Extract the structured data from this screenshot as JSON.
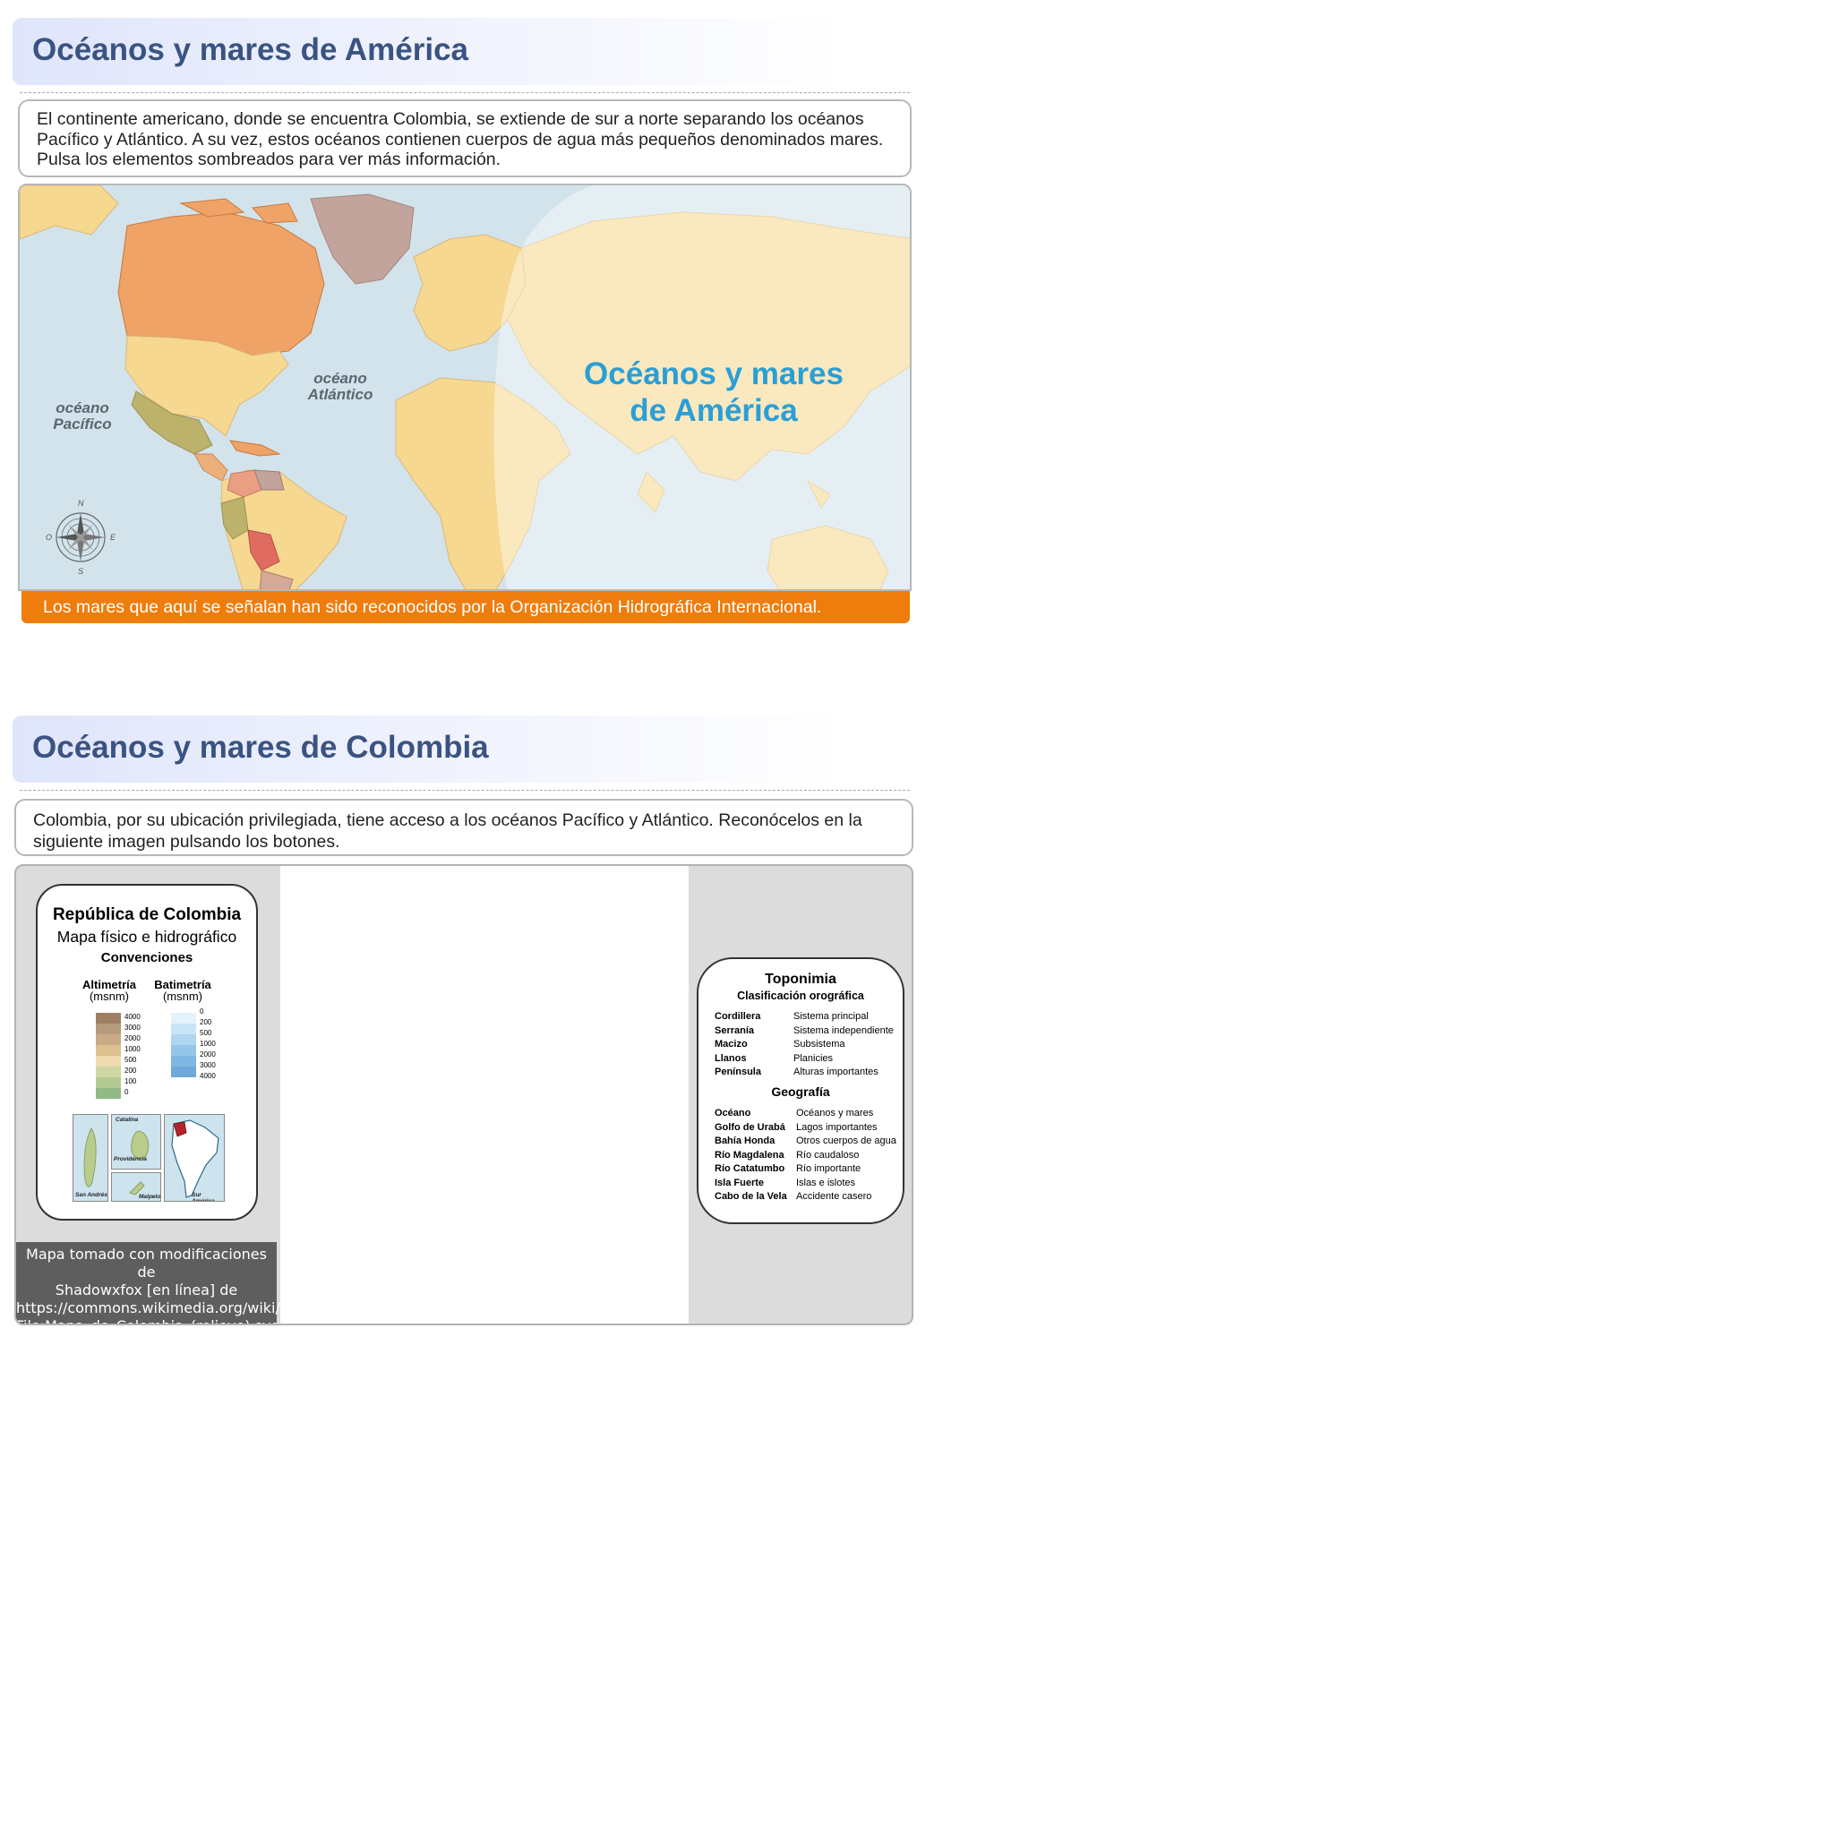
{
  "section1": {
    "title": "Océanos y mares de América",
    "intro": "El continente americano, donde se encuentra Colombia, se extiende de sur a norte separando los océanos Pacífico y Atlántico. A su vez, estos océanos contienen cuerpos de agua más pequeños denominados mares. Pulsa los elementos sombreados para ver más información.",
    "map": {
      "pacific_label_1": "océano",
      "pacific_label_2": "Pacífico",
      "atlantic_label_1": "océano",
      "atlantic_label_2": "Atlántico",
      "overlay_title_1": "Océanos y mares",
      "overlay_title_2": "de América",
      "compass": {
        "n": "N",
        "s": "S",
        "e": "E",
        "o": "O"
      }
    },
    "note": "Los mares que aquí se señalan han sido reconocidos por la Organización Hidrográfica Internacional."
  },
  "section2": {
    "title": "Océanos y mares de Colombia",
    "intro": "Colombia, por su ubicación privilegiada, tiene acceso a los océanos Pacífico y Atlántico. Reconócelos en la siguiente imagen pulsando los botones.",
    "legend": {
      "title": "República de Colombia",
      "subtitle": "Mapa físico e hidrográfico",
      "conventions": "Convenciones",
      "altimetry_label": "Altimetría",
      "altimetry_unit": "(msnm)",
      "bathymetry_label": "Batimetría",
      "bathymetry_unit": "(msnm)",
      "altimetry_ticks": [
        "4000",
        "3000",
        "2000",
        "1000",
        "500",
        "200",
        "100",
        "0"
      ],
      "bathymetry_ticks": [
        "0",
        "200",
        "500",
        "1000",
        "2000",
        "3000",
        "4000"
      ],
      "altimetry_colors": [
        "#9e7e62",
        "#b59a7c",
        "#c9ab86",
        "#dcc090",
        "#eedbae",
        "#cfd7a4",
        "#b2c994",
        "#93b986"
      ],
      "bathymetry_colors": [
        "#e3f2fb",
        "#c9e4f6",
        "#afd5f0",
        "#95c6ea",
        "#7fb7e2",
        "#6fa8d9"
      ],
      "insets": {
        "san_andres": "San Andrés",
        "catalina": "Catalina",
        "providencia": "Providencia",
        "malpelo": "Malpelo",
        "sur_america": "Sur América"
      }
    },
    "credit": [
      "Mapa tomado con modificaciones de",
      "Shadowxfox [en línea] de",
      "https://commons.wikimedia.org/wiki/",
      "File:Mapa_de_Colombia_(relieve).svg"
    ],
    "toponymy": {
      "title": "Toponimia",
      "subtitle": "Clasificación orográfica",
      "oro_rows": [
        {
          "term": "Cordillera",
          "desc": "Sistema principal"
        },
        {
          "term": "Serranía",
          "desc": "Sistema independiente"
        },
        {
          "term": "Macizo",
          "desc": "Subsistema"
        },
        {
          "term": "Llanos",
          "desc": "Planicies"
        },
        {
          "term": "Península",
          "desc": "Alturas importantes"
        }
      ],
      "geo_title": "Geografía",
      "geo_rows": [
        {
          "term": "Océano",
          "desc": "Océanos y mares"
        },
        {
          "term": "Golfo de Urabá",
          "desc": "Lagos importantes"
        },
        {
          "term": "Bahía Honda",
          "desc": "Otros cuerpos de agua"
        },
        {
          "term": "Río Magdalena",
          "desc": "Río caudaloso"
        },
        {
          "term": "Río Catatumbo",
          "desc": "Río importante"
        },
        {
          "term": "Isla Fuerte",
          "desc": "Islas e islotes"
        },
        {
          "term": "Cabo de la Vela",
          "desc": "Accidente casero"
        }
      ]
    }
  }
}
